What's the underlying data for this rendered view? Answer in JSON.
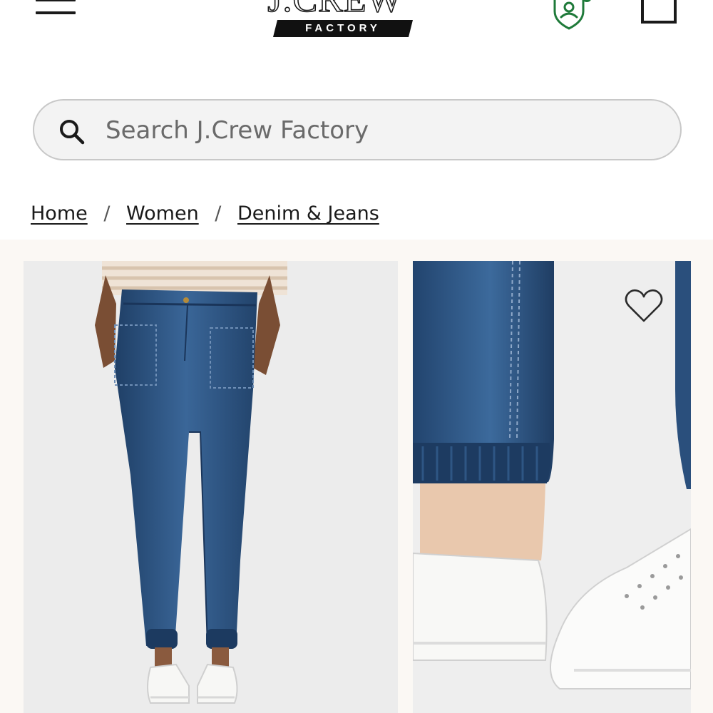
{
  "header": {
    "menu_icon": "hamburger-menu-icon",
    "logo": {
      "wordmark": "J.CREW",
      "subtitle": "FACTORY"
    },
    "rewards_icon": "rewards-badge-icon",
    "bag_icon": "shopping-bag-icon"
  },
  "search": {
    "placeholder": "Search J.Crew Factory",
    "value": "",
    "icon": "search-icon"
  },
  "breadcrumb": {
    "items": [
      {
        "label": "Home"
      },
      {
        "label": "Women"
      },
      {
        "label": "Denim & Jeans"
      }
    ],
    "separator": "/"
  },
  "gallery": {
    "favorite_icon": "heart-outline-icon"
  },
  "colors": {
    "text": "#1a1a1a",
    "search_bg": "#f3f3f3",
    "search_border": "#c8c8c8",
    "gallery_bg": "#fbf8f4",
    "rewards_accent": "#1f7a3a",
    "denim": "#2f5a8c"
  }
}
